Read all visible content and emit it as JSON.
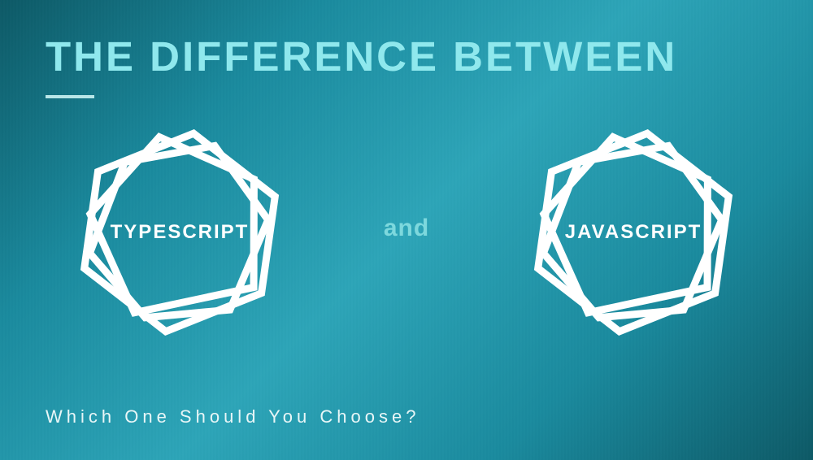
{
  "header": {
    "title": "THE DIFFERENCE BETWEEN"
  },
  "comparison": {
    "left_label": "TYPESCRIPT",
    "connector": "and",
    "right_label": "JAVASCRIPT"
  },
  "footer": {
    "subtitle": "Which One Should You Choose?"
  },
  "colors": {
    "title": "#8fe8ed",
    "accent": "#7dd8dd",
    "text": "#ffffff",
    "subtitle": "#e8f6f7"
  }
}
